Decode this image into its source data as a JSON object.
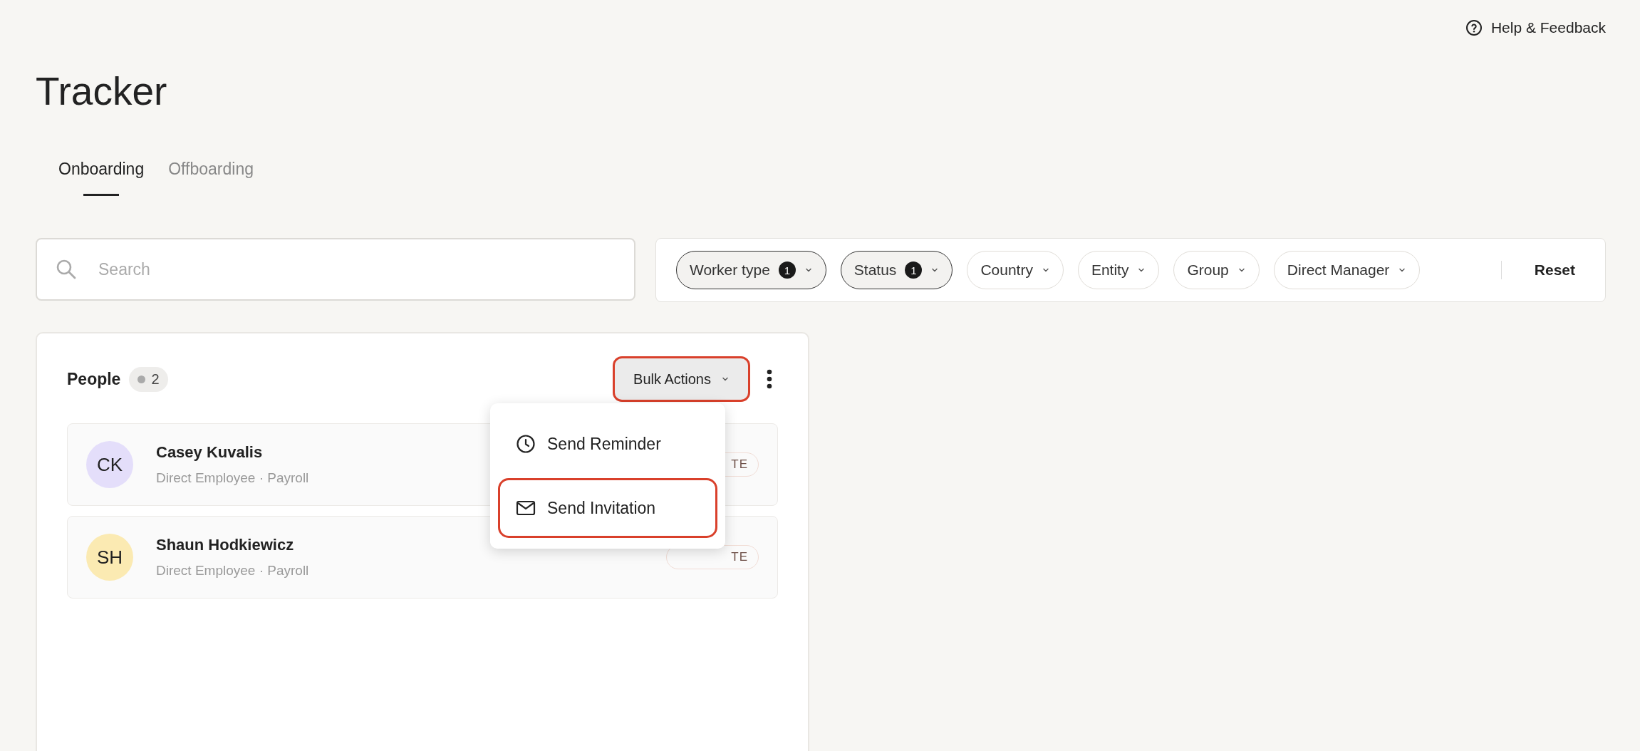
{
  "header": {
    "help_link": "Help & Feedback"
  },
  "title": "Tracker",
  "tabs": [
    {
      "label": "Onboarding",
      "selected": true
    },
    {
      "label": "Offboarding",
      "selected": false
    }
  ],
  "search": {
    "placeholder": "Search"
  },
  "filters": [
    {
      "label": "Worker type",
      "count": "1",
      "active": true
    },
    {
      "label": "Status",
      "count": "1",
      "active": true
    },
    {
      "label": "Country",
      "active": false
    },
    {
      "label": "Entity",
      "active": false
    },
    {
      "label": "Group",
      "active": false
    },
    {
      "label": "Direct Manager",
      "active": false
    }
  ],
  "reset_button": "Reset",
  "people": {
    "title": "People",
    "count": "2",
    "bulk_actions": {
      "label": "Bulk Actions",
      "highlighted": true
    },
    "rows": [
      {
        "initials": "CK",
        "name": "Casey Kuvalis",
        "details": "Direct Employee · Payroll",
        "status": "TE",
        "color": "#e4defa"
      },
      {
        "initials": "SH",
        "name": "Shaun Hodkiewicz",
        "details": "Direct Employee · Payroll",
        "status": "TE",
        "color": "#fbeab2"
      }
    ]
  },
  "menu": [
    {
      "kind": "reminder",
      "label": "Send Reminder",
      "highlighted": false
    },
    {
      "kind": "invitation",
      "label": "Send Invitation",
      "highlighted": true
    }
  ]
}
